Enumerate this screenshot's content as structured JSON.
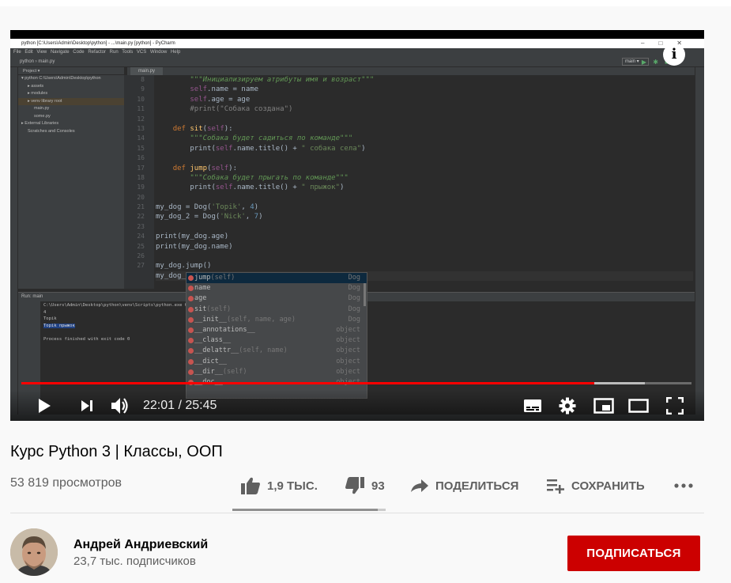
{
  "ide": {
    "window_title": "python [C:\\Users\\Admin\\Desktop\\python] - ...\\main.py [python] - PyCharm",
    "menu": [
      "File",
      "Edit",
      "View",
      "Navigate",
      "Code",
      "Refactor",
      "Run",
      "Tools",
      "VCS",
      "Window",
      "Help"
    ],
    "nav_path": [
      "python",
      "main.py"
    ],
    "run_config": "main",
    "project_header": "Project ▾",
    "tree": [
      {
        "label": "▾ python  C:\\Users\\Admin\\Desktop\\python",
        "indent": 0,
        "selected": false
      },
      {
        "label": "▸ assets",
        "indent": 1,
        "selected": false
      },
      {
        "label": "▸ modules",
        "indent": 1,
        "selected": false
      },
      {
        "label": "▸ venv  library root",
        "indent": 1,
        "selected": true
      },
      {
        "label": "main.py",
        "indent": 2,
        "selected": false
      },
      {
        "label": "some.py",
        "indent": 2,
        "selected": false
      },
      {
        "label": "▸ External Libraries",
        "indent": 0,
        "selected": false
      },
      {
        "label": "Scratches and Consoles",
        "indent": 1,
        "selected": false
      }
    ],
    "editor_tab": "main.py",
    "line_numbers": [
      "8",
      "9",
      "10",
      "11",
      "12",
      "13",
      "14",
      "15",
      "16",
      "17",
      "18",
      "19",
      "20",
      "21",
      "22",
      "23",
      "24",
      "25",
      "26",
      "27"
    ],
    "code_lines": [
      [
        {
          "t": "        ",
          "c": ""
        },
        {
          "t": "\"\"\"Инициализируем атрибуты имя и возраст\"\"\"",
          "c": "doc"
        }
      ],
      [
        {
          "t": "        ",
          "c": ""
        },
        {
          "t": "self",
          "c": "self"
        },
        {
          "t": ".name = name",
          "c": ""
        }
      ],
      [
        {
          "t": "        ",
          "c": ""
        },
        {
          "t": "self",
          "c": "self"
        },
        {
          "t": ".age = age",
          "c": ""
        }
      ],
      [
        {
          "t": "        ",
          "c": ""
        },
        {
          "t": "#print(\"Собака создана\")",
          "c": "cmt"
        }
      ],
      [
        {
          "t": "",
          "c": ""
        }
      ],
      [
        {
          "t": "    ",
          "c": ""
        },
        {
          "t": "def ",
          "c": "kw"
        },
        {
          "t": "sit",
          "c": "fn"
        },
        {
          "t": "(",
          "c": ""
        },
        {
          "t": "self",
          "c": "self"
        },
        {
          "t": "):",
          "c": ""
        }
      ],
      [
        {
          "t": "        ",
          "c": ""
        },
        {
          "t": "\"\"\"Собака будет садиться по команде\"\"\"",
          "c": "doc"
        }
      ],
      [
        {
          "t": "        print(",
          "c": ""
        },
        {
          "t": "self",
          "c": "self"
        },
        {
          "t": ".name.title() + ",
          "c": ""
        },
        {
          "t": "\" собака села\"",
          "c": "str"
        },
        {
          "t": ")",
          "c": ""
        }
      ],
      [
        {
          "t": "",
          "c": ""
        }
      ],
      [
        {
          "t": "    ",
          "c": ""
        },
        {
          "t": "def ",
          "c": "kw"
        },
        {
          "t": "jump",
          "c": "fn"
        },
        {
          "t": "(",
          "c": ""
        },
        {
          "t": "self",
          "c": "self"
        },
        {
          "t": "):",
          "c": ""
        }
      ],
      [
        {
          "t": "        ",
          "c": ""
        },
        {
          "t": "\"\"\"Собака будет прыгать по команде\"\"\"",
          "c": "doc"
        }
      ],
      [
        {
          "t": "        print(",
          "c": ""
        },
        {
          "t": "self",
          "c": "self"
        },
        {
          "t": ".name.title() + ",
          "c": ""
        },
        {
          "t": "\" прыжок\"",
          "c": "str"
        },
        {
          "t": ")",
          "c": ""
        }
      ],
      [
        {
          "t": "",
          "c": ""
        }
      ],
      [
        {
          "t": "my_dog = Dog(",
          "c": ""
        },
        {
          "t": "'Topik'",
          "c": "str"
        },
        {
          "t": ", ",
          "c": ""
        },
        {
          "t": "4",
          "c": "num"
        },
        {
          "t": ")",
          "c": ""
        }
      ],
      [
        {
          "t": "my_dog_2 = Dog(",
          "c": ""
        },
        {
          "t": "'Nick'",
          "c": "str"
        },
        {
          "t": ", ",
          "c": ""
        },
        {
          "t": "7",
          "c": "num"
        },
        {
          "t": ")",
          "c": ""
        }
      ],
      [
        {
          "t": "",
          "c": ""
        }
      ],
      [
        {
          "t": "print(my_dog.age)",
          "c": ""
        }
      ],
      [
        {
          "t": "print(my_dog.name)",
          "c": ""
        }
      ],
      [
        {
          "t": "",
          "c": ""
        }
      ],
      [
        {
          "t": "my_dog.jump()",
          "c": ""
        }
      ],
      [
        {
          "t": "my_dog_2.",
          "c": ""
        }
      ]
    ],
    "run_header": "Run:   main",
    "console_lines": [
      {
        "text": "C:\\Users\\Admin\\Desktop\\python\\venv\\Scripts\\python.exe C:/",
        "hl": false
      },
      {
        "text": "4",
        "hl": false
      },
      {
        "text": "Topik",
        "hl": false
      },
      {
        "text": "Topik прыжок",
        "hl": true
      },
      {
        "text": "",
        "hl": false
      },
      {
        "text": "Process finished with exit code 0",
        "hl": false
      }
    ],
    "completion": [
      {
        "name": "jump",
        "sig": "(self)",
        "owner": "Dog",
        "selected": true
      },
      {
        "name": "name",
        "sig": "",
        "owner": "Dog",
        "selected": false
      },
      {
        "name": "age",
        "sig": "",
        "owner": "Dog",
        "selected": false
      },
      {
        "name": "sit",
        "sig": "(self)",
        "owner": "Dog",
        "selected": false
      },
      {
        "name": "__init__",
        "sig": "(self, name, age)",
        "owner": "Dog",
        "selected": false
      },
      {
        "name": "__annotations__",
        "sig": "",
        "owner": "object",
        "selected": false
      },
      {
        "name": "__class__",
        "sig": "",
        "owner": "object",
        "selected": false
      },
      {
        "name": "__delattr__",
        "sig": "(self, name)",
        "owner": "object",
        "selected": false
      },
      {
        "name": "__dict__",
        "sig": "",
        "owner": "object",
        "selected": false
      },
      {
        "name": "__dir__",
        "sig": "(self)",
        "owner": "object",
        "selected": false
      },
      {
        "name": "__doc__",
        "sig": "",
        "owner": "object",
        "selected": false
      }
    ]
  },
  "player": {
    "time_current": "22:01",
    "time_total": "25:45",
    "time_display": "22:01 / 25:45",
    "progress_fraction": 0.855,
    "buffered_fraction": 0.93,
    "info_glyph": "i",
    "accent": "#ff0000"
  },
  "video": {
    "title": "Курс Python 3 | Классы, ООП",
    "views": "53 819 просмотров",
    "likes": "1,9 ТЫС.",
    "dislikes": "93",
    "share": "ПОДЕЛИТЬСЯ",
    "save": "СОХРАНИТЬ",
    "like_ratio": 0.95
  },
  "channel": {
    "name": "Андрей Андриевский",
    "subscribers": "23,7 тыс. подписчиков",
    "subscribe": "ПОДПИСАТЬСЯ",
    "subscribe_color": "#cc0000"
  },
  "icons": {
    "play": "play-icon",
    "next": "next-icon",
    "volume": "volume-icon",
    "subtitles": "subtitles-icon",
    "settings": "gear-icon",
    "miniplayer": "miniplayer-icon",
    "theater": "theater-icon",
    "fullscreen": "fullscreen-icon",
    "like": "thumbs-up-icon",
    "dislike": "thumbs-down-icon",
    "share": "share-icon",
    "save": "playlist-add-icon",
    "more": "more-icon"
  }
}
